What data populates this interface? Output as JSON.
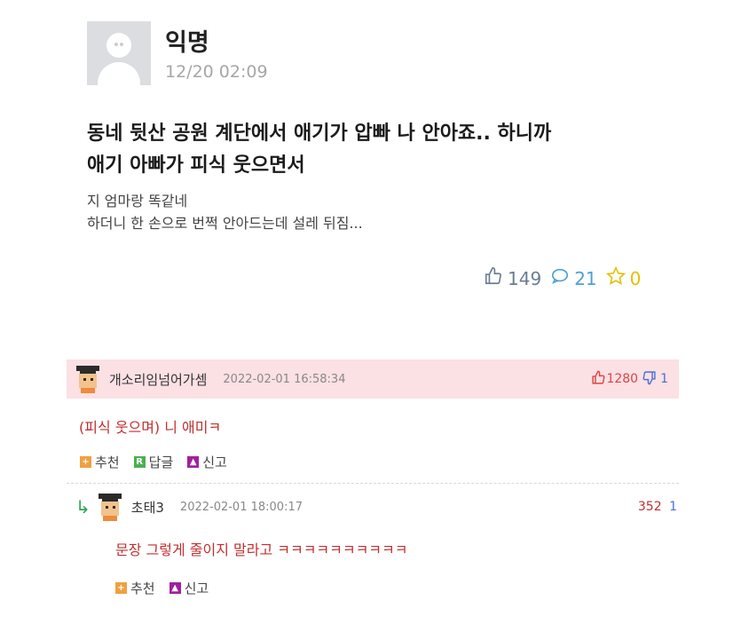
{
  "post": {
    "author": "익명",
    "date": "12/20 02:09",
    "title_line1": "동네 뒷산 공원 계단에서 애기가 압빠 나 안아죠.. 하니까",
    "title_line2": "애기 아빠가 피식 웃으면서",
    "content_line1": "지 엄마랑 똑같네",
    "content_line2": "하더니 한 손으로 번쩍 안아드는데 설레 뒤짐...",
    "likes": "149",
    "comments": "21",
    "scraps": "0"
  },
  "comments": [
    {
      "name": "개소리임넘어가셈",
      "date": "2022-02-01 16:58:34",
      "upvotes": "1280",
      "downvotes": "1",
      "text": "(피식 웃으며) 니 애미ㅋ",
      "recommend_label": "추천",
      "reply_label": "답글",
      "report_label": "신고"
    }
  ],
  "replies": [
    {
      "name": "초태3",
      "date": "2022-02-01 18:00:17",
      "upvotes": "352",
      "downvotes": "1",
      "text": "문장 그렇게 줄이지 말라고 ㅋㅋㅋㅋㅋㅋㅋㅋㅋㅋ",
      "recommend_label": "추천",
      "report_label": "신고"
    }
  ],
  "colors": {
    "comment_highlight": "#fbe0e4",
    "comment_text": "#c03030",
    "like_count": "#6b7c92",
    "comment_count": "#4fa0d8",
    "scrap_count": "#e4c100"
  }
}
